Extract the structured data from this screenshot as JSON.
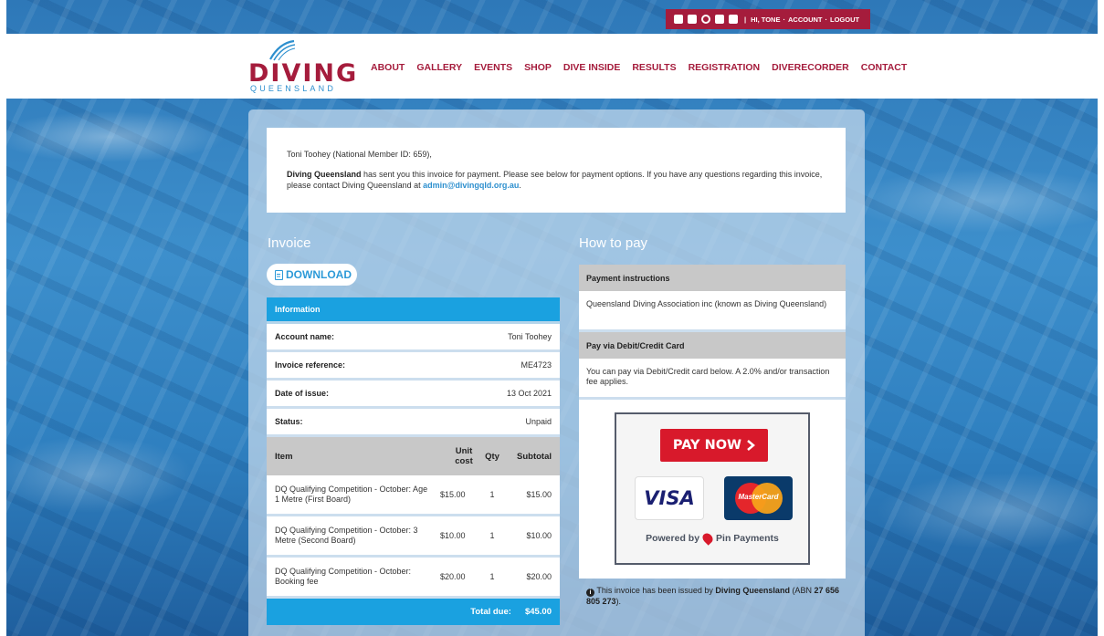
{
  "utility": {
    "greeting": "HI, TONE",
    "account": "ACCOUNT",
    "logout": "LOGOUT",
    "dot": "·"
  },
  "logo": {
    "word": "DIVING",
    "sub": "QUEENSLAND"
  },
  "nav": [
    "ABOUT",
    "GALLERY",
    "EVENTS",
    "SHOP",
    "DIVE INSIDE",
    "RESULTS",
    "REGISTRATION",
    "DIVERECORDER",
    "CONTACT"
  ],
  "intro": {
    "salutation": "Toni Toohey (National Member ID: 659),",
    "org": "Diving Queensland",
    "message": " has sent you this invoice for payment. Please see below for payment options. If you have any questions regarding this invoice, please contact Diving Queensland at ",
    "email": "admin@divingqld.org.au",
    "end": "."
  },
  "invoice": {
    "heading": "Invoice",
    "download": "DOWNLOAD",
    "info_header": "Information",
    "fields": [
      {
        "k": "Account name:",
        "v": "Toni Toohey"
      },
      {
        "k": "Invoice reference:",
        "v": "ME4723"
      },
      {
        "k": "Date of issue:",
        "v": "13 Oct 2021"
      },
      {
        "k": "Status:",
        "v": "Unpaid"
      }
    ],
    "columns": {
      "item": "Item",
      "unit": "Unit cost",
      "qty": "Qty",
      "subtotal": "Subtotal"
    },
    "items": [
      {
        "name": "DQ Qualifying Competition - October: Age 1 Metre (First Board)",
        "unit": "$15.00",
        "qty": "1",
        "subtotal": "$15.00"
      },
      {
        "name": "DQ Qualifying Competition - October: 3 Metre (Second Board)",
        "unit": "$10.00",
        "qty": "1",
        "subtotal": "$10.00"
      },
      {
        "name": "DQ Qualifying Competition - October: Booking fee",
        "unit": "$20.00",
        "qty": "1",
        "subtotal": "$20.00"
      }
    ],
    "total_label": "Total due:",
    "total_value": "$45.00"
  },
  "pay": {
    "heading": "How to pay",
    "instructions_header": "Payment instructions",
    "instructions_body": "Queensland Diving Association inc (known as Diving Queensland)",
    "card_header": "Pay via Debit/Credit Card",
    "card_body": "You can pay via Debit/Credit card below. A 2.0% and/or transaction fee applies.",
    "paynow": "PAY NOW",
    "visa": "VISA",
    "mastercard": "MasterCard",
    "powered_prefix": "Powered by",
    "powered_name": "Pin Payments",
    "notice_prefix": "This invoice has been issued by ",
    "notice_org": "Diving Queensland",
    "notice_abn_prefix": " (ABN ",
    "notice_abn": "27 656 805 273",
    "notice_end": ")."
  },
  "colors": {
    "brand": "#a51c3c",
    "accent": "#1aa1e0",
    "link": "#2d8fce"
  }
}
